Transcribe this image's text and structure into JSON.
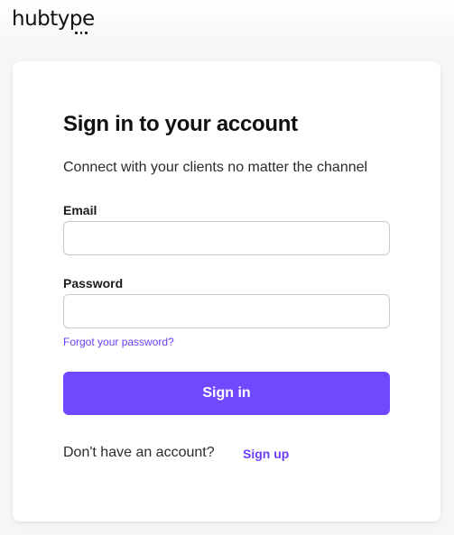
{
  "brand": {
    "logo_text": "hubtype"
  },
  "login": {
    "title": "Sign in to your account",
    "subtitle": "Connect with your clients no matter the channel",
    "email_label": "Email",
    "email_value": "",
    "password_label": "Password",
    "password_value": "",
    "forgot_link": "Forgot your password?",
    "signin_button": "Sign in",
    "no_account_text": "Don't have an account?",
    "signup_link": "Sign up"
  },
  "colors": {
    "accent": "#7049ff",
    "link": "#6c3ef4",
    "background": "#f6f6f7",
    "card": "#ffffff"
  }
}
